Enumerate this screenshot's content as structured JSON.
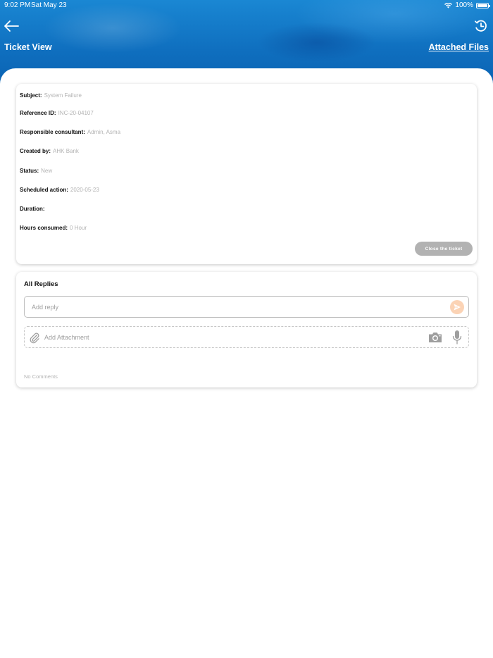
{
  "status_bar": {
    "time": "9:02 PM",
    "date": "Sat May 23",
    "battery": "100%"
  },
  "header": {
    "title": "Ticket View",
    "attached_files_label": "Attached Files",
    "back_icon": "arrow-left-icon",
    "history_icon": "clock-history-icon"
  },
  "ticket": {
    "fields": [
      {
        "label": "Subject:",
        "value": "System Failure"
      },
      {
        "label": "Reference ID:",
        "value": "INC-20-04107"
      },
      {
        "label": "Responsible consultant:",
        "value": "Admin, Asma"
      },
      {
        "label": "Created by:",
        "value": "AHK Bank"
      },
      {
        "label": "Status:",
        "value": "New"
      },
      {
        "label": "Scheduled action:",
        "value": "2020-05-23"
      },
      {
        "label": "Duration:",
        "value": ""
      },
      {
        "label": "Hours consumed:",
        "value": "0 Hour"
      }
    ],
    "close_button_label": "Close the ticket"
  },
  "replies": {
    "title": "All Replies",
    "reply_placeholder": "Add reply",
    "reply_value": "",
    "attachment_label": "Add Attachment",
    "empty_text": "No Comments"
  },
  "colors": {
    "header_blue": "#0f6fbf",
    "send_button": "#fbd3b5",
    "close_button": "#b2b2b2",
    "value_text": "#b3b3b3"
  }
}
